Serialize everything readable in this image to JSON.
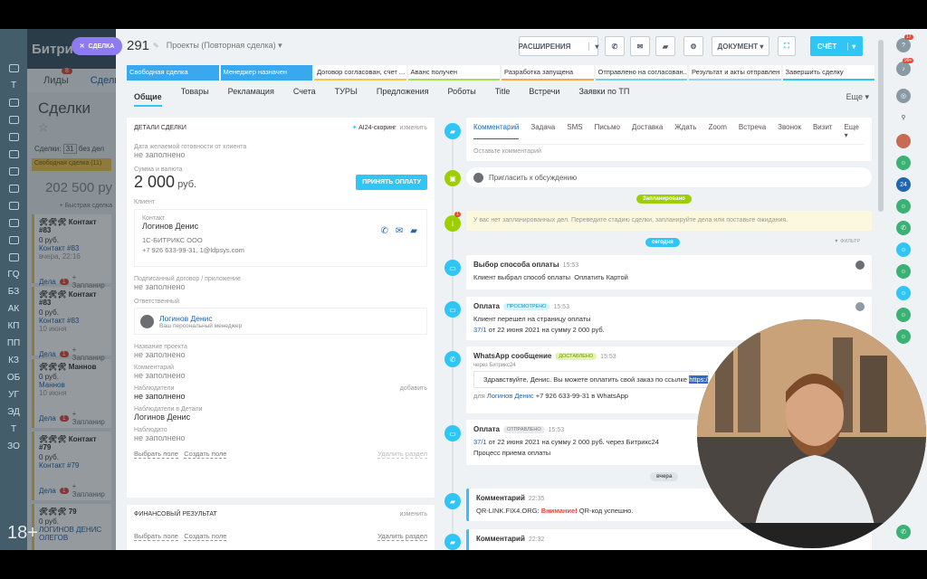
{
  "rail_items": [
    "",
    "Т",
    "",
    "",
    "",
    "",
    "",
    "",
    "",
    "",
    "",
    "",
    "ГQ",
    "БЗ",
    "АК",
    "КП",
    "ПП",
    "КЗ",
    "ОБ",
    "УГ",
    "ЭД",
    "Т",
    "ЗО"
  ],
  "bg": {
    "app_title": "Битри",
    "tab_leads": "Лиды",
    "leads_badge": "8",
    "tab_deals": "Сделк",
    "heading": "Сделки",
    "summary_label": "Сделки:",
    "summary_count": "31",
    "summary_suffix": "без дел",
    "stage_label": "Свободная сделка (11)",
    "total_amount": "202 500 ру",
    "quick_deal": "+ Быстрая сделка",
    "cards": [
      {
        "stars": "🛠🛠🛠",
        "title": "Контакт #83",
        "amount": "0 руб.",
        "contact": "Контакт #83",
        "date": "вчера, 22:16",
        "tasks": "Дела",
        "badge": "1",
        "plan": "+ Запланир"
      },
      {
        "stars": "🛠🛠🛠",
        "title": "Контакт #83",
        "amount": "0 руб.",
        "contact": "Контакт #83",
        "date": "10 июня",
        "tasks": "Дела",
        "badge": "1",
        "plan": "+ Запланир"
      },
      {
        "stars": "🛠🛠🛠",
        "title": "Маннов",
        "amount": "0 руб.",
        "contact": "Маннов",
        "date": "10 июня",
        "tasks": "Дела",
        "badge": "1",
        "plan": "+ Запланир"
      },
      {
        "stars": "🛠🛠🛠",
        "title": "Контакт #79",
        "amount": "0 руб.",
        "contact": "Контакт #79",
        "date": "",
        "tasks": "Дела",
        "badge": "1",
        "plan": "+ Запланир"
      },
      {
        "stars": "🛠🛠🛠",
        "title": "79",
        "amount": "0 руб.",
        "contact": "ЛОГИНОВ ДЕНИС ОЛЕГОВ",
        "date": "",
        "tasks": "",
        "badge": "",
        "plan": ""
      }
    ]
  },
  "close_button": "СДЕЛКА",
  "header": {
    "deal_id": "291",
    "category": "Проекты (Повторная сделка)",
    "extensions_label": "РАСШИРЕНИЯ",
    "document_label": "ДОКУМЕНТ",
    "invoice_label": "СЧЁТ"
  },
  "stages": [
    {
      "label": "Свободная сделка",
      "active": true
    },
    {
      "label": "Менеджер назначен",
      "active": true
    },
    {
      "label": "Договор согласован, счет ...",
      "active": false,
      "color": "#f3c54b"
    },
    {
      "label": "Аванс получен",
      "active": false,
      "color": "#a8dc5b"
    },
    {
      "label": "Разработка запущена",
      "active": false,
      "color": "#f7a84a"
    },
    {
      "label": "Отправлено на согласован...",
      "active": false,
      "color": "#73d0e6"
    },
    {
      "label": "Результат и акты отправлен",
      "active": false,
      "color": "#9ecfee"
    },
    {
      "label": "Завершить сделку",
      "active": false,
      "color": "#2fc6f6"
    }
  ],
  "tabs": [
    "Общие",
    "Товары",
    "Рекламация",
    "Счета",
    "ТУРЫ",
    "Предложения",
    "Роботы",
    "Title",
    "Встречи",
    "Заявки по ТП"
  ],
  "tabs_more": "Еще",
  "details": {
    "title": "ДЕТАЛИ СДЕЛКИ",
    "ai_scoring": "AI24-скоринг",
    "edit": "изменить",
    "date_label": "Дата желаемой готовности от клиента",
    "not_filled": "не заполнено",
    "sum_label": "Сумма и валюта",
    "sum_value": "2 000",
    "sum_currency": "руб.",
    "accept_payment": "ПРИНЯТЬ ОПЛАТУ",
    "client_label": "Клиент",
    "contact_label": "Контакт",
    "contact_name": "Логинов Денис",
    "company": "1С-БИТРИКС ООО",
    "contact_info": "+7 926 633-99-31, 1@ldpsys.com",
    "contract_label": "Подписанный договор / приложение",
    "responsible_label": "Ответственный",
    "responsible_name": "Логинов Денис",
    "responsible_role": "Ваш персональный менеджер",
    "project_label": "Название проекта",
    "comment_label": "Комментарий",
    "observers_label": "Наблюдатели",
    "add": "добавить",
    "observers_detail_label": "Наблюдатели в Детали",
    "observers_detail_value": "Логинов Денис",
    "observers2_label": "Наблюдато",
    "choose_field": "Выбрать поле",
    "create_field": "Создать поле",
    "delete_section": "Удалить раздел",
    "financial_title": "ФИНАНСОВЫЙ РЕЗУЛЬТАТ"
  },
  "timeline": {
    "composer_tabs": [
      "Комментарий",
      "Задача",
      "SMS",
      "Письмо",
      "Доставка",
      "Ждать",
      "Zoom",
      "Встреча",
      "Звонок",
      "Визит"
    ],
    "composer_more": "Еще",
    "composer_placeholder": "Оставьте комментарий",
    "invite": "Пригласить к обсуждению",
    "planned_badge": "Запланировано",
    "no_tasks": "У вас нет запланированных дел. Переведите стадию сделки, запланируйте дела или поставьте ожидания.",
    "today_badge": "сегодня",
    "filter": "ФИЛЬТР",
    "yesterday_badge": "вчера",
    "entries": [
      {
        "title": "Выбор способа оплаты",
        "time": "15:53",
        "line1": "Клиент выбрал способ оплаты",
        "line1b": "Оплатить Картой"
      },
      {
        "title": "Оплата",
        "pill": "ПРОСМОТРЕНО",
        "time": "15:53",
        "line1": "Клиент перешел на страницу оплаты",
        "link": "37/1",
        "line2": " от 22 июня 2021 на сумму 2 000 руб."
      },
      {
        "title": "WhatsApp сообщение",
        "pill": "ДОСТАВЛЕНО",
        "time": "15:53",
        "via": "через Битрикс24",
        "message": "Здравствуйте, Денис. Вы можете оплатить свой заказ по ссылке",
        "message_link": "https://crm4",
        "for_label": "для",
        "for_name": "Логинов Денис",
        "for_rest": " +7 926 633-99-31 в WhatsApp"
      },
      {
        "title": "Оплата",
        "pill": "ОТПРАВЛЕНО",
        "time": "15:53",
        "link": "37/1",
        "line2": " от 22 июня 2021 на сумму 2 000 руб. через Битрикс24",
        "process": "Процесс приема оплаты"
      },
      {
        "title": "Комментарий",
        "time": "22:35",
        "line1": "QR-LINK.FIX4.ORG:",
        "warn": "Внимание!",
        "line1c": " QR-код успешно."
      },
      {
        "title": "Комментарий",
        "time": "22:32"
      }
    ]
  },
  "right_rail_badges": {
    "notif": "17",
    "chat": "99+"
  },
  "age_rating": "18+",
  "colors": {
    "accent": "#2fc6f6",
    "link": "#2067b0",
    "green": "#9dcf00",
    "stage_active": "#39a8ef",
    "rail": "#445d6a"
  }
}
